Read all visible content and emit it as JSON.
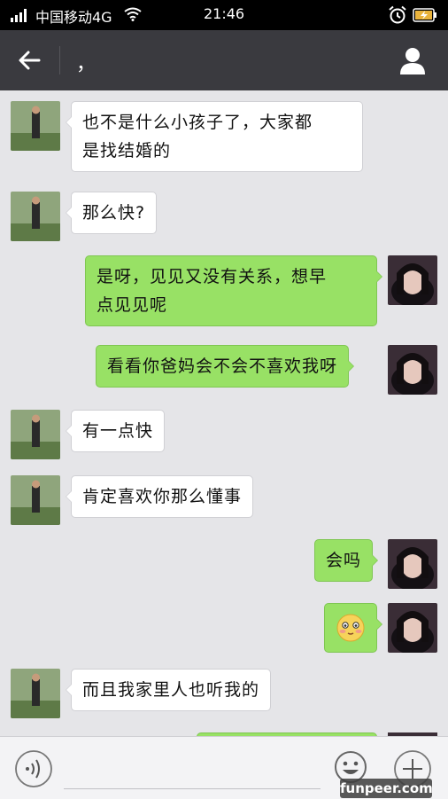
{
  "status_bar": {
    "carrier": "中国移动4G",
    "time": "21:46"
  },
  "header": {
    "title": "，",
    "back_icon": "arrow-left-icon",
    "contact_icon": "person-icon"
  },
  "messages": [
    {
      "side": "left",
      "text_lines": [
        "也不是什么小孩子了，大家都",
        "是找结婚的"
      ]
    },
    {
      "side": "left",
      "text_lines": [
        "那么快?"
      ]
    },
    {
      "side": "right",
      "text_lines": [
        "是呀，见见又没有关系，想早",
        "点见见呢"
      ]
    },
    {
      "side": "right",
      "text_lines": [
        "看看你爸妈会不会不喜欢我呀"
      ]
    },
    {
      "side": "left",
      "text_lines": [
        "有一点快"
      ]
    },
    {
      "side": "left",
      "text_lines": [
        "肯定喜欢你那么懂事"
      ]
    },
    {
      "side": "right",
      "text_lines": [
        "会吗"
      ]
    },
    {
      "side": "right",
      "emoji": "blushing-face-emoji"
    },
    {
      "side": "left",
      "text_lines": [
        "而且我家里人也听我的"
      ]
    }
  ],
  "input_bar": {
    "voice_icon": "voice-icon",
    "emoji_icon": "smiley-icon",
    "add_icon": "plus-icon"
  },
  "watermark": "funpeer.com",
  "colors": {
    "status_bar_bg": "#000000",
    "title_bar_bg": "#3a3a3f",
    "chat_bg": "#e5e5e8",
    "incoming_bubble": "#ffffff",
    "outgoing_bubble": "#98e165"
  }
}
